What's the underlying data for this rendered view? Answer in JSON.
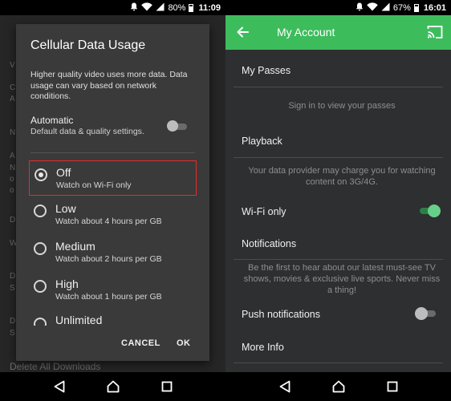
{
  "left": {
    "status": {
      "battery": "80%",
      "time": "11:09"
    },
    "background": {
      "fragments": [
        "V",
        "C",
        "A",
        "N",
        "A",
        "N",
        "o",
        "o",
        "D",
        "W",
        "D",
        "S",
        "D",
        "S"
      ],
      "bottom_item": "Delete All Downloads"
    },
    "dialog": {
      "title": "Cellular Data Usage",
      "description": "Higher quality video uses more data. Data usage can vary based on network conditions.",
      "automatic": {
        "title": "Automatic",
        "subtitle": "Default data & quality settings.",
        "enabled": false
      },
      "options": [
        {
          "label": "Off",
          "sub": "Watch on Wi-Fi only",
          "checked": true
        },
        {
          "label": "Low",
          "sub": "Watch about 4 hours per GB",
          "checked": false
        },
        {
          "label": "Medium",
          "sub": "Watch about 2 hours per GB",
          "checked": false
        },
        {
          "label": "High",
          "sub": "Watch about 1 hours per GB",
          "checked": false
        },
        {
          "label": "Unlimited",
          "sub": "",
          "checked": false
        }
      ],
      "cancel_label": "CANCEL",
      "ok_label": "OK"
    }
  },
  "right": {
    "status": {
      "battery": "67%",
      "time": "16:01"
    },
    "appbar": {
      "title": "My Account",
      "color": "#3dbc5c"
    },
    "sections": {
      "passes_title": "My Passes",
      "passes_note": "Sign in to view your passes",
      "playback_title": "Playback",
      "playback_note": "Your data provider may charge you for watching content on 3G/4G.",
      "wifi_label": "Wi-Fi only",
      "wifi_enabled": true,
      "notifications_title": "Notifications",
      "notifications_note": "Be the first to hear about our latest must-see TV shows, movies & exclusive live sports. Never miss a thing!",
      "push_label": "Push notifications",
      "push_enabled": false,
      "more_info_title": "More Info"
    }
  },
  "colors": {
    "accent_green": "#3dbc5c",
    "highlight_red": "#e02e2e"
  },
  "icons": {
    "nav": [
      "back-triangle-icon",
      "home-circle-icon",
      "recents-square-icon"
    ],
    "status": [
      "notification-bell-icon",
      "wifi-icon",
      "signal-icon",
      "battery-icon"
    ],
    "appbar": [
      "arrow-back-icon",
      "cast-icon"
    ]
  }
}
